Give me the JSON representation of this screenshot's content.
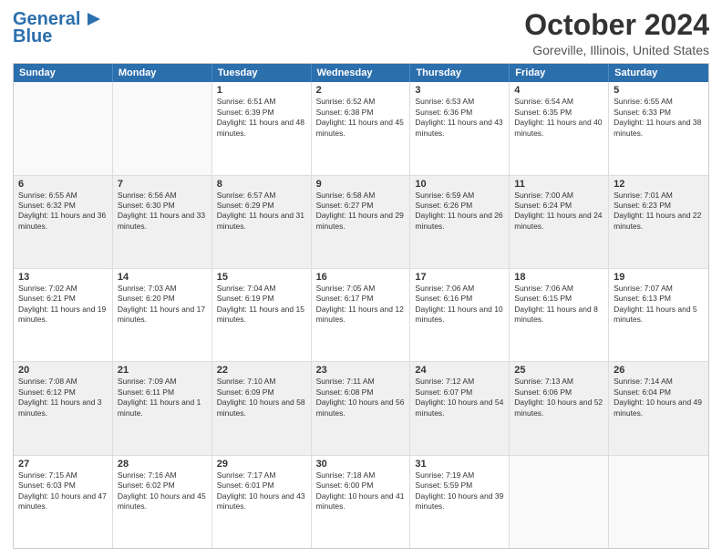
{
  "header": {
    "logo_line1": "General",
    "logo_line2": "Blue",
    "main_title": "October 2024",
    "subtitle": "Goreville, Illinois, United States"
  },
  "days_of_week": [
    "Sunday",
    "Monday",
    "Tuesday",
    "Wednesday",
    "Thursday",
    "Friday",
    "Saturday"
  ],
  "weeks": [
    [
      {
        "day": "",
        "info": "",
        "empty": true
      },
      {
        "day": "",
        "info": "",
        "empty": true
      },
      {
        "day": "1",
        "info": "Sunrise: 6:51 AM\nSunset: 6:39 PM\nDaylight: 11 hours and 48 minutes.",
        "empty": false
      },
      {
        "day": "2",
        "info": "Sunrise: 6:52 AM\nSunset: 6:38 PM\nDaylight: 11 hours and 45 minutes.",
        "empty": false
      },
      {
        "day": "3",
        "info": "Sunrise: 6:53 AM\nSunset: 6:36 PM\nDaylight: 11 hours and 43 minutes.",
        "empty": false
      },
      {
        "day": "4",
        "info": "Sunrise: 6:54 AM\nSunset: 6:35 PM\nDaylight: 11 hours and 40 minutes.",
        "empty": false
      },
      {
        "day": "5",
        "info": "Sunrise: 6:55 AM\nSunset: 6:33 PM\nDaylight: 11 hours and 38 minutes.",
        "empty": false
      }
    ],
    [
      {
        "day": "6",
        "info": "Sunrise: 6:55 AM\nSunset: 6:32 PM\nDaylight: 11 hours and 36 minutes.",
        "empty": false,
        "shaded": true
      },
      {
        "day": "7",
        "info": "Sunrise: 6:56 AM\nSunset: 6:30 PM\nDaylight: 11 hours and 33 minutes.",
        "empty": false,
        "shaded": true
      },
      {
        "day": "8",
        "info": "Sunrise: 6:57 AM\nSunset: 6:29 PM\nDaylight: 11 hours and 31 minutes.",
        "empty": false,
        "shaded": true
      },
      {
        "day": "9",
        "info": "Sunrise: 6:58 AM\nSunset: 6:27 PM\nDaylight: 11 hours and 29 minutes.",
        "empty": false,
        "shaded": true
      },
      {
        "day": "10",
        "info": "Sunrise: 6:59 AM\nSunset: 6:26 PM\nDaylight: 11 hours and 26 minutes.",
        "empty": false,
        "shaded": true
      },
      {
        "day": "11",
        "info": "Sunrise: 7:00 AM\nSunset: 6:24 PM\nDaylight: 11 hours and 24 minutes.",
        "empty": false,
        "shaded": true
      },
      {
        "day": "12",
        "info": "Sunrise: 7:01 AM\nSunset: 6:23 PM\nDaylight: 11 hours and 22 minutes.",
        "empty": false,
        "shaded": true
      }
    ],
    [
      {
        "day": "13",
        "info": "Sunrise: 7:02 AM\nSunset: 6:21 PM\nDaylight: 11 hours and 19 minutes.",
        "empty": false
      },
      {
        "day": "14",
        "info": "Sunrise: 7:03 AM\nSunset: 6:20 PM\nDaylight: 11 hours and 17 minutes.",
        "empty": false
      },
      {
        "day": "15",
        "info": "Sunrise: 7:04 AM\nSunset: 6:19 PM\nDaylight: 11 hours and 15 minutes.",
        "empty": false
      },
      {
        "day": "16",
        "info": "Sunrise: 7:05 AM\nSunset: 6:17 PM\nDaylight: 11 hours and 12 minutes.",
        "empty": false
      },
      {
        "day": "17",
        "info": "Sunrise: 7:06 AM\nSunset: 6:16 PM\nDaylight: 11 hours and 10 minutes.",
        "empty": false
      },
      {
        "day": "18",
        "info": "Sunrise: 7:06 AM\nSunset: 6:15 PM\nDaylight: 11 hours and 8 minutes.",
        "empty": false
      },
      {
        "day": "19",
        "info": "Sunrise: 7:07 AM\nSunset: 6:13 PM\nDaylight: 11 hours and 5 minutes.",
        "empty": false
      }
    ],
    [
      {
        "day": "20",
        "info": "Sunrise: 7:08 AM\nSunset: 6:12 PM\nDaylight: 11 hours and 3 minutes.",
        "empty": false,
        "shaded": true
      },
      {
        "day": "21",
        "info": "Sunrise: 7:09 AM\nSunset: 6:11 PM\nDaylight: 11 hours and 1 minute.",
        "empty": false,
        "shaded": true
      },
      {
        "day": "22",
        "info": "Sunrise: 7:10 AM\nSunset: 6:09 PM\nDaylight: 10 hours and 58 minutes.",
        "empty": false,
        "shaded": true
      },
      {
        "day": "23",
        "info": "Sunrise: 7:11 AM\nSunset: 6:08 PM\nDaylight: 10 hours and 56 minutes.",
        "empty": false,
        "shaded": true
      },
      {
        "day": "24",
        "info": "Sunrise: 7:12 AM\nSunset: 6:07 PM\nDaylight: 10 hours and 54 minutes.",
        "empty": false,
        "shaded": true
      },
      {
        "day": "25",
        "info": "Sunrise: 7:13 AM\nSunset: 6:06 PM\nDaylight: 10 hours and 52 minutes.",
        "empty": false,
        "shaded": true
      },
      {
        "day": "26",
        "info": "Sunrise: 7:14 AM\nSunset: 6:04 PM\nDaylight: 10 hours and 49 minutes.",
        "empty": false,
        "shaded": true
      }
    ],
    [
      {
        "day": "27",
        "info": "Sunrise: 7:15 AM\nSunset: 6:03 PM\nDaylight: 10 hours and 47 minutes.",
        "empty": false
      },
      {
        "day": "28",
        "info": "Sunrise: 7:16 AM\nSunset: 6:02 PM\nDaylight: 10 hours and 45 minutes.",
        "empty": false
      },
      {
        "day": "29",
        "info": "Sunrise: 7:17 AM\nSunset: 6:01 PM\nDaylight: 10 hours and 43 minutes.",
        "empty": false
      },
      {
        "day": "30",
        "info": "Sunrise: 7:18 AM\nSunset: 6:00 PM\nDaylight: 10 hours and 41 minutes.",
        "empty": false
      },
      {
        "day": "31",
        "info": "Sunrise: 7:19 AM\nSunset: 5:59 PM\nDaylight: 10 hours and 39 minutes.",
        "empty": false
      },
      {
        "day": "",
        "info": "",
        "empty": true
      },
      {
        "day": "",
        "info": "",
        "empty": true
      }
    ]
  ]
}
